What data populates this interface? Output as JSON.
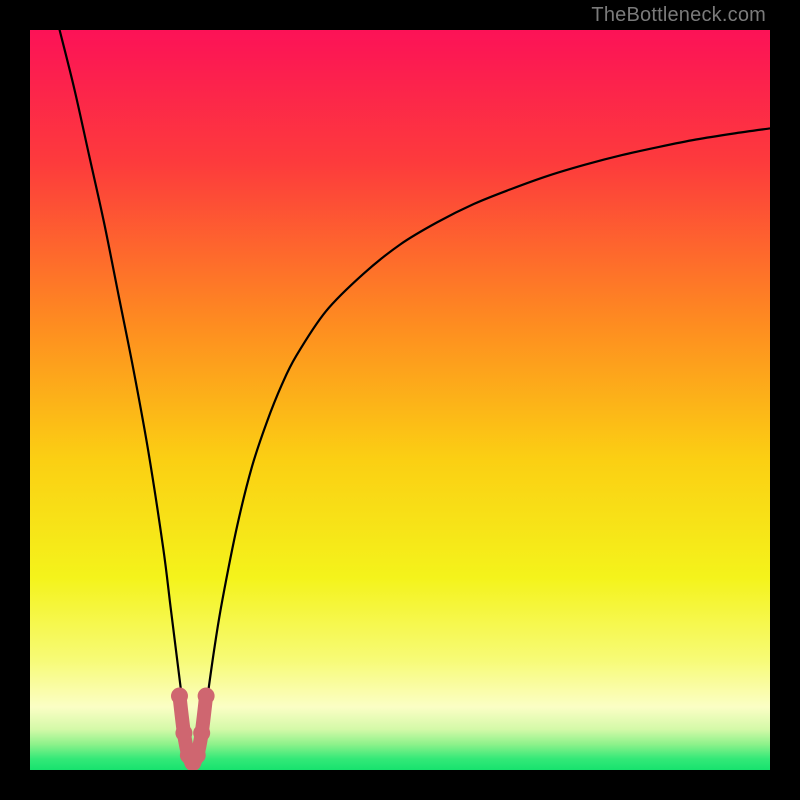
{
  "watermark": "TheBottleneck.com",
  "chart_data": {
    "type": "line",
    "title": "",
    "xlabel": "",
    "ylabel": "",
    "xlim": [
      0,
      100
    ],
    "ylim": [
      0,
      100
    ],
    "grid": false,
    "series": [
      {
        "name": "bottleneck-curve",
        "x": [
          4,
          6,
          8,
          10,
          12,
          14,
          16,
          18,
          19,
          20,
          20.5,
          21,
          21.5,
          22,
          22.5,
          23,
          23.5,
          24,
          25,
          26,
          28,
          30,
          32,
          34,
          36,
          40,
          45,
          50,
          55,
          60,
          65,
          70,
          75,
          80,
          85,
          90,
          95,
          100
        ],
        "y": [
          100,
          92,
          83,
          74,
          64,
          54,
          43,
          30,
          22,
          14,
          10,
          6,
          3,
          1,
          1,
          3,
          6,
          10,
          17,
          23,
          33,
          41,
          47,
          52,
          56,
          62,
          67,
          71,
          74,
          76.5,
          78.5,
          80.3,
          81.8,
          83.1,
          84.2,
          85.2,
          86,
          86.7
        ]
      }
    ],
    "highlight": {
      "name": "valley-marker",
      "color": "#cf6670",
      "x": [
        20.2,
        20.8,
        21.4,
        22.0,
        22.6,
        23.2,
        23.8
      ],
      "y": [
        10,
        5,
        2,
        1,
        2,
        5,
        10
      ]
    },
    "background_gradient": {
      "stops": [
        {
          "pos": 0.0,
          "color": "#fc1257"
        },
        {
          "pos": 0.18,
          "color": "#fd3b3c"
        },
        {
          "pos": 0.4,
          "color": "#fe8d20"
        },
        {
          "pos": 0.58,
          "color": "#fbcf13"
        },
        {
          "pos": 0.74,
          "color": "#f4f31b"
        },
        {
          "pos": 0.85,
          "color": "#f7fb75"
        },
        {
          "pos": 0.915,
          "color": "#fbfec5"
        },
        {
          "pos": 0.945,
          "color": "#d4f9a8"
        },
        {
          "pos": 0.965,
          "color": "#8ef28b"
        },
        {
          "pos": 0.985,
          "color": "#33e978"
        },
        {
          "pos": 1.0,
          "color": "#17e26e"
        }
      ]
    }
  }
}
